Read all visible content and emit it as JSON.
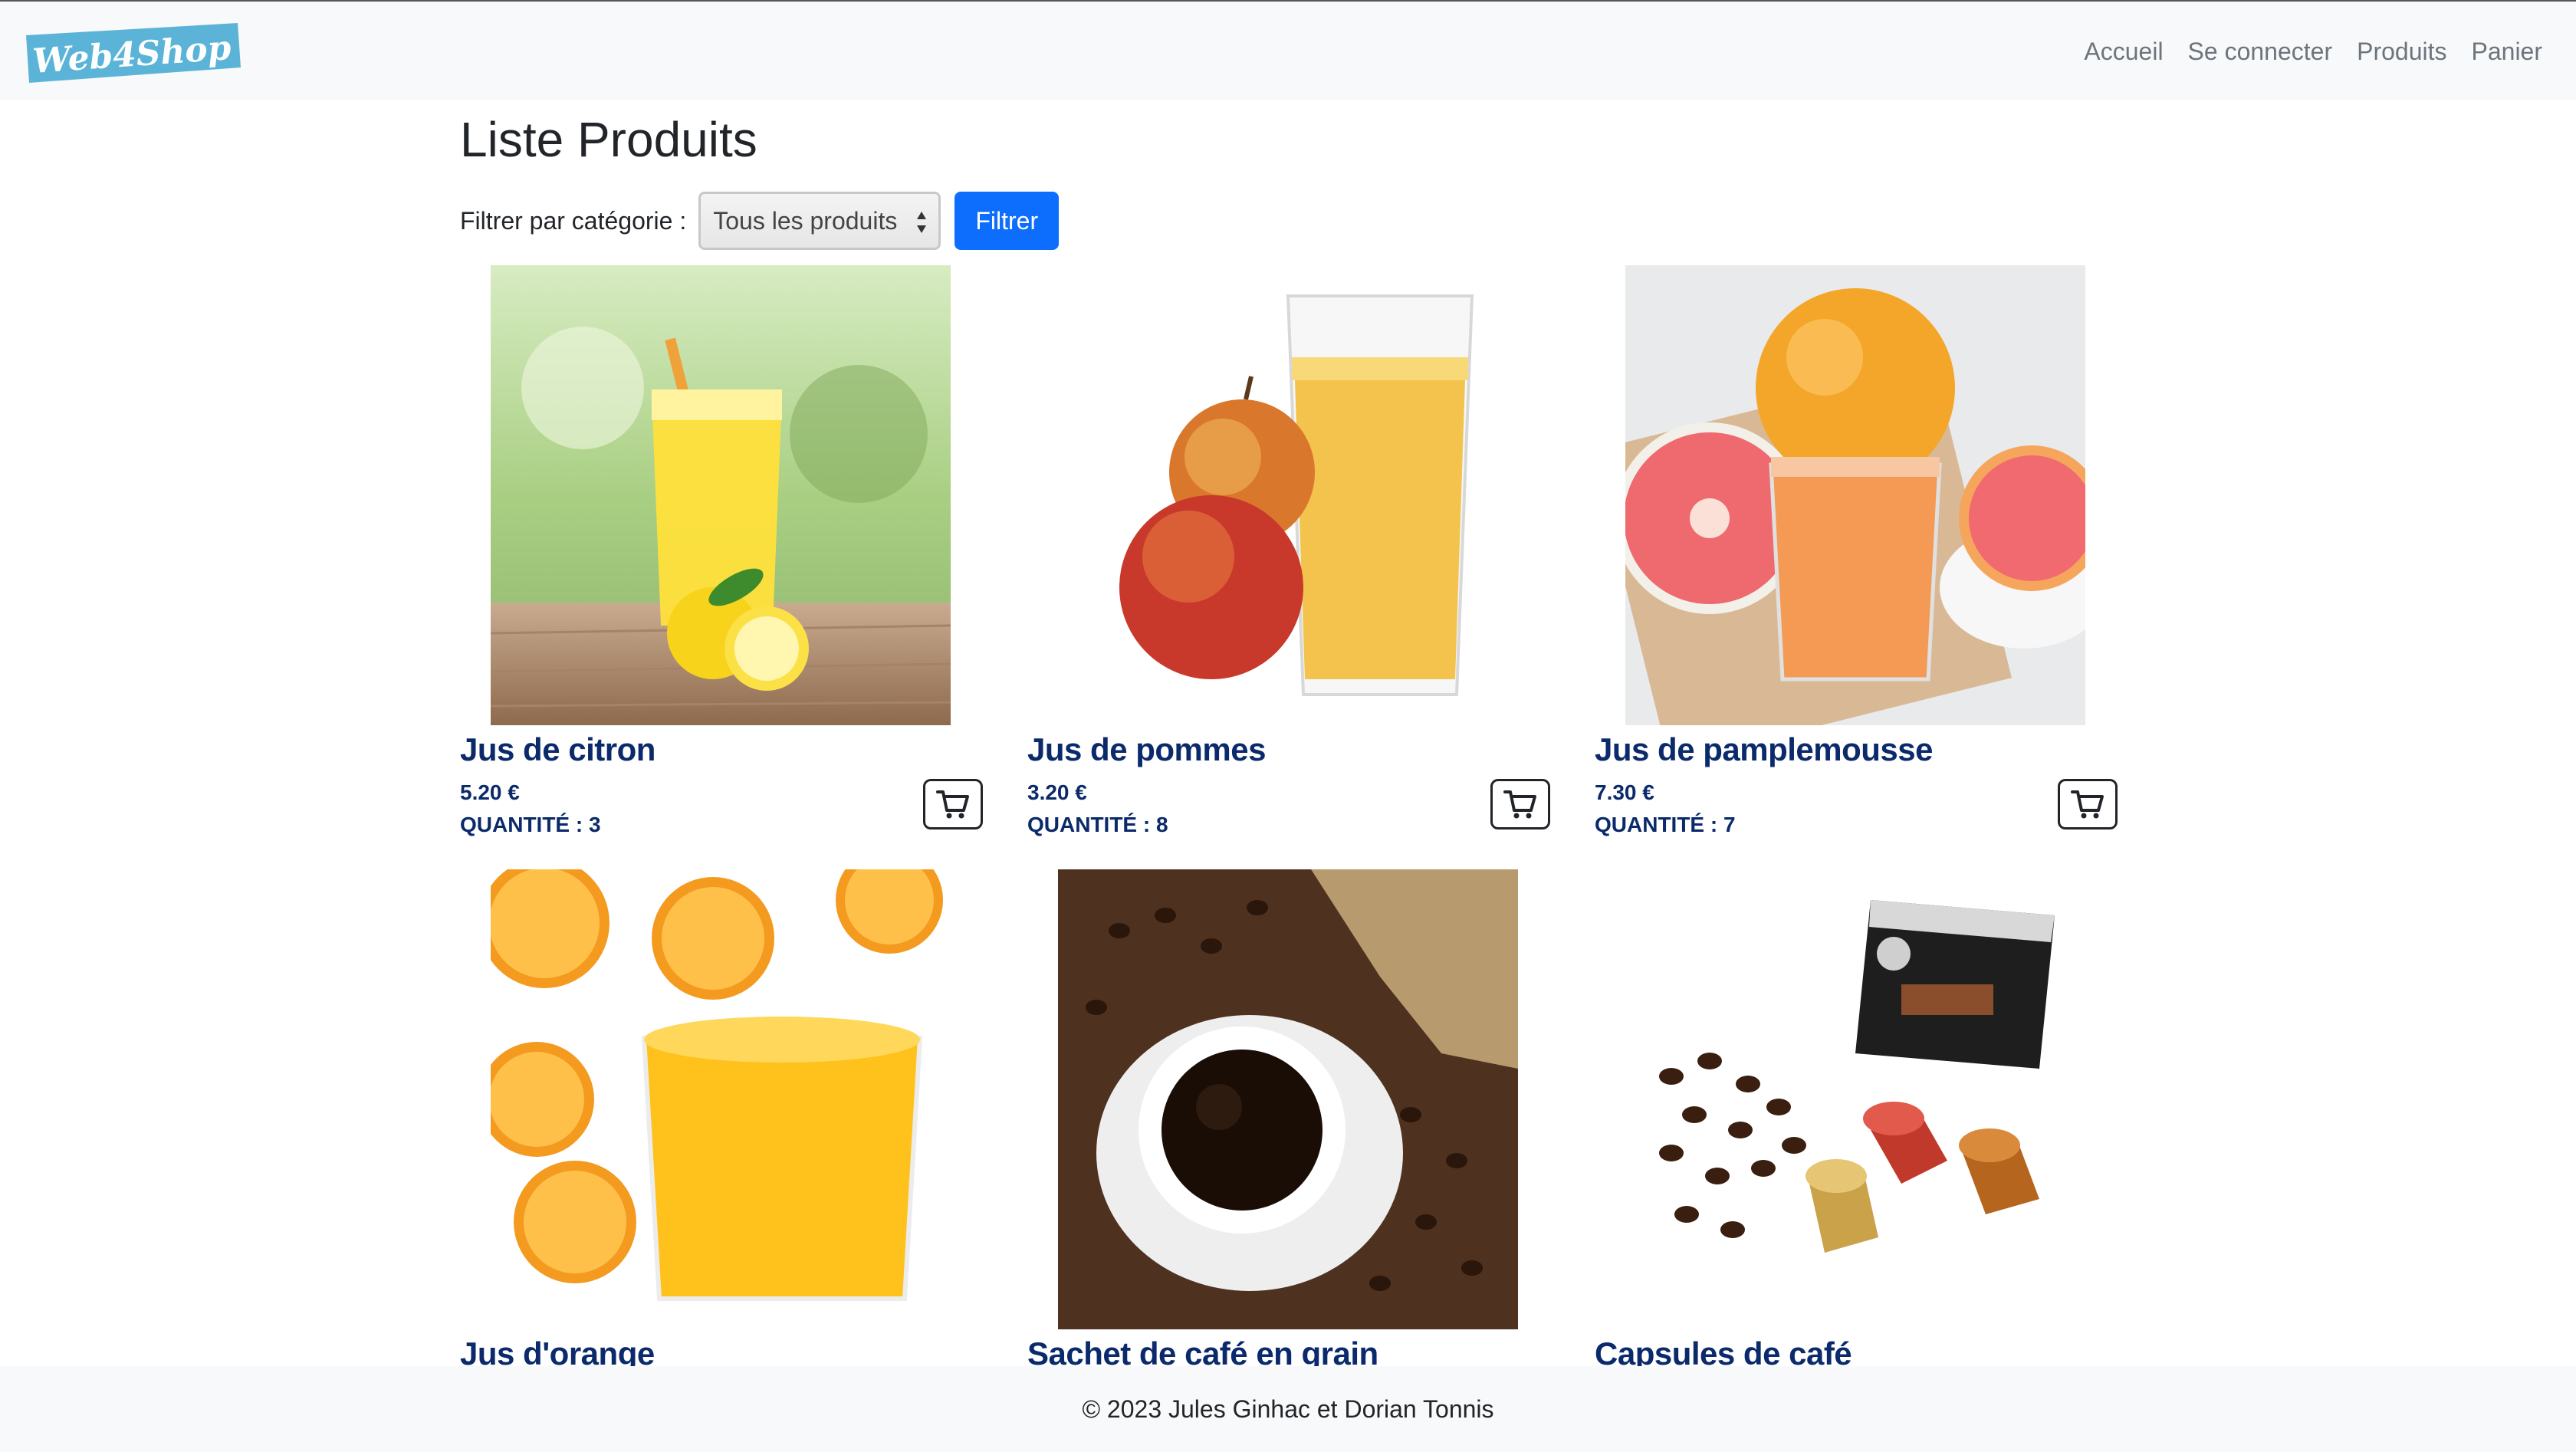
{
  "brand": {
    "logo_text": "Web4Shop",
    "logo_color": "#5bb4d8"
  },
  "nav": {
    "links": [
      "Accueil",
      "Se connecter",
      "Produits",
      "Panier"
    ]
  },
  "main": {
    "title": "Liste Produits",
    "filter": {
      "label": "Filtrer par catégorie :",
      "selected": "Tous les produits",
      "button": "Filtrer"
    },
    "products": [
      {
        "name": "Jus de citron",
        "price": "5.20 €",
        "quantity": "QUANTITÉ : 3",
        "image": "lemonade-glass-lemons-image"
      },
      {
        "name": "Jus de pommes",
        "price": "3.20 €",
        "quantity": "QUANTITÉ : 8",
        "image": "apple-juice-glass-apples-image"
      },
      {
        "name": "Jus de pamplemousse",
        "price": "7.30 €",
        "quantity": "QUANTITÉ : 7",
        "image": "grapefruit-juice-glass-image"
      },
      {
        "name": "Jus d'orange",
        "image": "orange-juice-glass-oranges-image"
      },
      {
        "name": "Sachet de café en grain",
        "image": "coffee-cup-beans-sack-image"
      },
      {
        "name": "Capsules de café",
        "image": "coffee-capsules-box-image"
      }
    ]
  },
  "footer": {
    "text": "© 2023 Jules Ginhac et Dorian Tonnis"
  },
  "colors": {
    "accent": "#0d6efd",
    "product_title": "#0b2a6b",
    "navbar_bg": "#f8f9fa"
  }
}
